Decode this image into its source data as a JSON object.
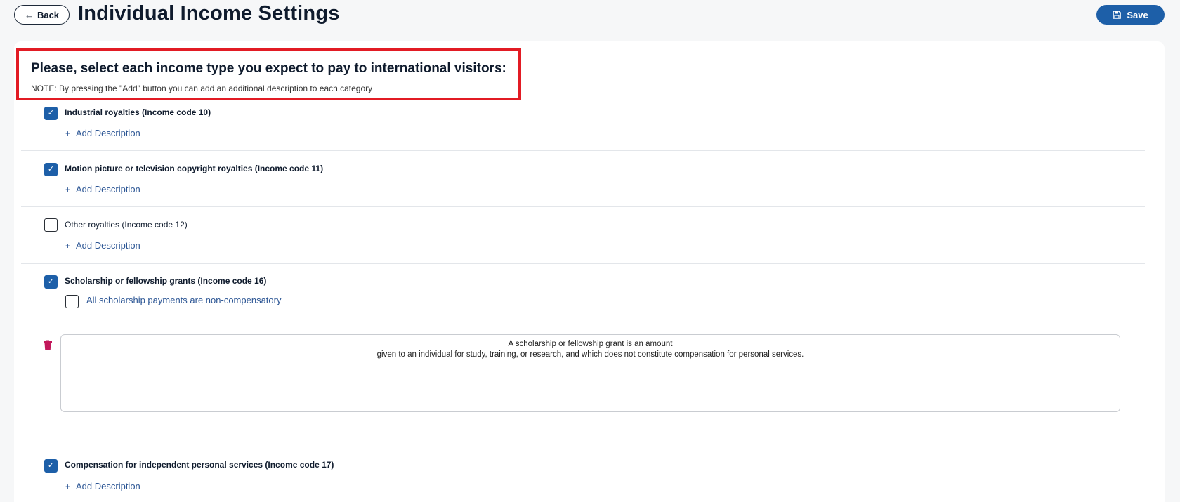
{
  "header": {
    "back_label": "Back",
    "title": "Individual Income Settings",
    "save_label": "Save"
  },
  "intro": {
    "title": "Please, select each income type you expect to pay to international visitors:",
    "note": "NOTE: By pressing the \"Add\" button you can add an additional description to each category"
  },
  "add_description_label": "Add Description",
  "items": [
    {
      "label": "Industrial royalties (Income code 10)",
      "checked": true
    },
    {
      "label": "Motion picture or television copyright royalties (Income code 11)",
      "checked": true
    },
    {
      "label": "Other royalties (Income code 12)",
      "checked": false
    },
    {
      "label": "Scholarship or fellowship grants (Income code 16)",
      "checked": true,
      "sub_option": {
        "label": "All scholarship payments are non-compensatory",
        "checked": false
      },
      "description": {
        "line1": "A scholarship or fellowship grant is an amount",
        "line2": "given to an individual for study, training, or research, and which does not constitute compensation for personal services."
      }
    },
    {
      "label": "Compensation for independent personal services (Income code 17)",
      "checked": true
    }
  ],
  "colors": {
    "accent": "#1d5fa8",
    "highlight_border": "#e21b24",
    "delete": "#c2185b",
    "link": "#2b5594"
  },
  "icons": {
    "back": "arrow-left-icon",
    "save": "floppy-disk-icon",
    "checkbox": "checkmark-icon",
    "add": "plus-icon",
    "delete": "trash-icon"
  }
}
